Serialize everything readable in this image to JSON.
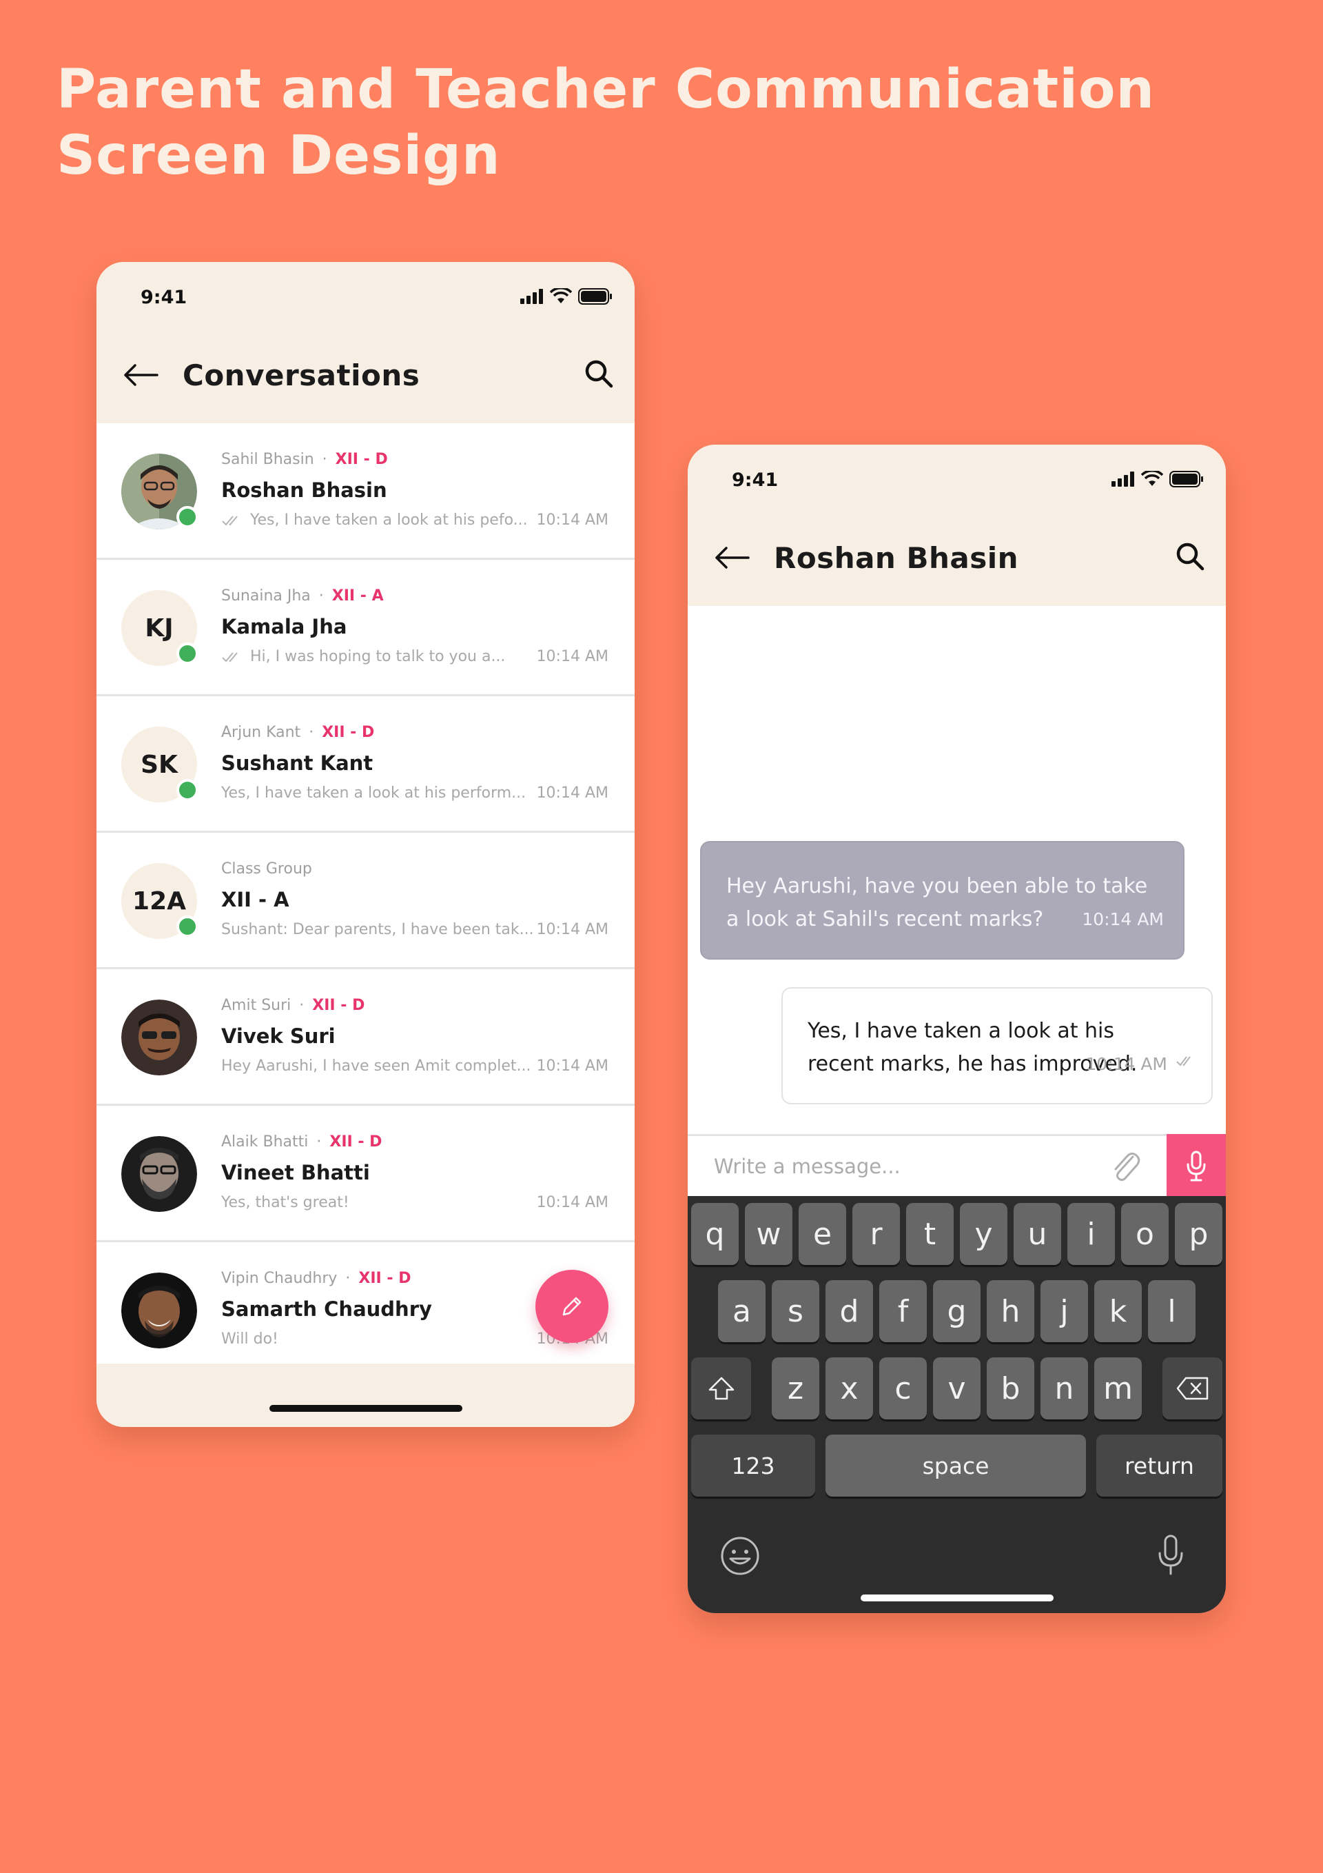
{
  "page": {
    "title": "Parent and Teacher Communication Screen Design",
    "background_color": "#FF8160"
  },
  "colors": {
    "header_bg": "#F8EFE4",
    "accent_pink": "#F6527F",
    "class_tag": "#E8336C",
    "online": "#3FAF5A",
    "incoming_bubble": "#ACAAB8",
    "keyboard_bg": "#2D2D2D"
  },
  "conversations_screen": {
    "status_time": "9:41",
    "header_title": "Conversations",
    "icons": [
      "back-arrow-icon",
      "search-icon",
      "signal-icon",
      "wifi-icon",
      "battery-icon",
      "pencil-icon"
    ],
    "items": [
      {
        "parent": "Sahil Bhasin",
        "class": "XII - D",
        "name": "Roshan Bhasin",
        "preview": "Yes, I have taken a look at his pefo...",
        "time": "10:14 AM",
        "avatar": "photo",
        "online": true,
        "read_ticks": true
      },
      {
        "parent": "Sunaina Jha",
        "class": "XII - A",
        "name": "Kamala Jha",
        "preview": "Hi, I was hoping to talk to you a...",
        "time": "10:14 AM",
        "avatar": "KJ",
        "online": true,
        "read_ticks": true
      },
      {
        "parent": "Arjun Kant",
        "class": "XII - D",
        "name": "Sushant Kant",
        "preview": "Yes, I have taken a look at his perform...",
        "time": "10:14 AM",
        "avatar": "SK",
        "online": true,
        "read_ticks": false
      },
      {
        "parent": "Class Group",
        "class": "",
        "name": "XII - A",
        "preview": "Sushant: Dear parents, I have been tak...",
        "time": "10:14 AM",
        "avatar": "12A",
        "online": true,
        "read_ticks": false
      },
      {
        "parent": "Amit Suri",
        "class": "XII - D",
        "name": "Vivek Suri",
        "preview": "Hey Aarushi, I have seen Amit complet...",
        "time": "10:14 AM",
        "avatar": "photo",
        "online": false,
        "read_ticks": false
      },
      {
        "parent": "Alaik Bhatti",
        "class": "XII - D",
        "name": "Vineet Bhatti",
        "preview": "Yes, that's great!",
        "time": "10:14 AM",
        "avatar": "photo",
        "online": false,
        "read_ticks": false
      },
      {
        "parent": "Vipin Chaudhry",
        "class": "XII - D",
        "name": "Samarth Chaudhry",
        "preview": "Will do!",
        "time": "10:14 AM",
        "avatar": "photo",
        "online": false,
        "read_ticks": false
      }
    ],
    "separator": "·"
  },
  "chat_screen": {
    "status_time": "9:41",
    "header_title": "Roshan Bhasin",
    "messages": [
      {
        "direction": "in",
        "text": "Hey Aarushi, have you been able to take a look at Sahil's recent marks?",
        "time": "10:14 AM"
      },
      {
        "direction": "out",
        "text": "Yes, I have taken a look at his recent marks, he has improved.",
        "time": "10:14 AM"
      }
    ],
    "composer_placeholder": "Write a message...",
    "keyboard": {
      "row1": [
        "q",
        "w",
        "e",
        "r",
        "t",
        "y",
        "u",
        "i",
        "o",
        "p"
      ],
      "row2": [
        "a",
        "s",
        "d",
        "f",
        "g",
        "h",
        "j",
        "k",
        "l"
      ],
      "row3": [
        "z",
        "x",
        "c",
        "v",
        "b",
        "n",
        "m"
      ],
      "numbers_key": "123",
      "space_key": "space",
      "return_key": "return"
    }
  }
}
